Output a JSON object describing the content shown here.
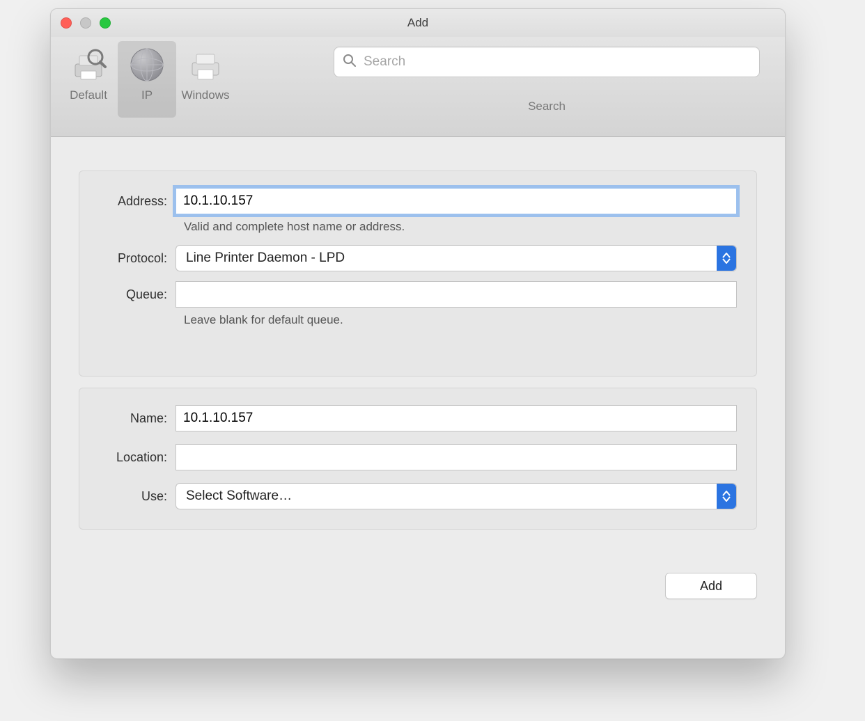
{
  "window": {
    "title": "Add"
  },
  "toolbar": {
    "tabs": [
      {
        "label": "Default",
        "icon": "printer-search-icon",
        "selected": false
      },
      {
        "label": "IP",
        "icon": "globe-icon",
        "selected": true
      },
      {
        "label": "Windows",
        "icon": "printer-icon",
        "selected": false
      }
    ],
    "search_placeholder": "Search",
    "search_label": "Search"
  },
  "form": {
    "address": {
      "label": "Address:",
      "value": "10.1.10.157",
      "helper": "Valid and complete host name or address."
    },
    "protocol": {
      "label": "Protocol:",
      "value": "Line Printer Daemon - LPD"
    },
    "queue": {
      "label": "Queue:",
      "value": "",
      "helper": "Leave blank for default queue."
    },
    "name": {
      "label": "Name:",
      "value": "10.1.10.157"
    },
    "location": {
      "label": "Location:",
      "value": ""
    },
    "use": {
      "label": "Use:",
      "value": "Select Software…"
    }
  },
  "footer": {
    "add_label": "Add"
  }
}
